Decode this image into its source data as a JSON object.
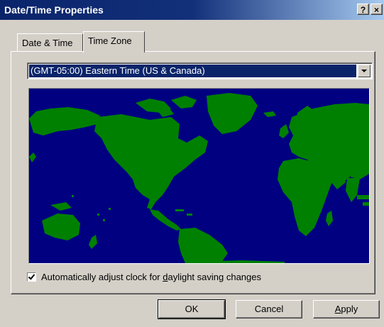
{
  "window": {
    "title": "Date/Time Properties",
    "help_button": "?",
    "close_button": "×"
  },
  "tabs": [
    {
      "label": "Date & Time",
      "active": false
    },
    {
      "label": "Time Zone",
      "active": true
    }
  ],
  "timezone": {
    "selected": "(GMT-05:00) Eastern Time (US & Canada)"
  },
  "map": {
    "ocean_color": "#000080",
    "land_color": "#008000"
  },
  "daylight": {
    "checked": true,
    "label_before": "Automatically adjust clock for ",
    "label_accel": "d",
    "label_after": "aylight saving changes"
  },
  "buttons": {
    "ok": "OK",
    "cancel": "Cancel",
    "apply": "Apply"
  }
}
